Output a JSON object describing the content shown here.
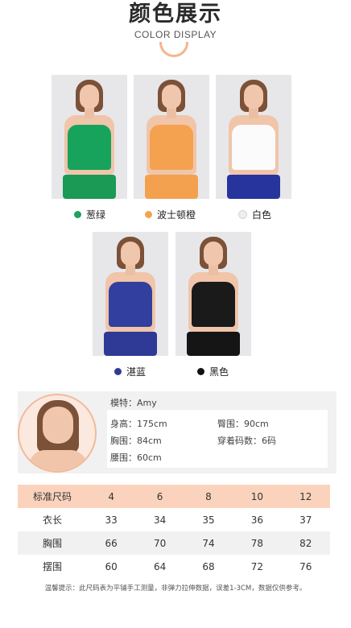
{
  "header": {
    "title": "颜色展示",
    "subtitle": "COLOR DISPLAY"
  },
  "colors": [
    {
      "name": "葱绿",
      "dot": "#1ea25c",
      "top": "#17a35b",
      "bottom": "#1a9a55"
    },
    {
      "name": "波士顿橙",
      "dot": "#f2a452",
      "top": "#f4a24f",
      "bottom": "#f3a14e"
    },
    {
      "name": "白色",
      "dot": "#eeeeee",
      "top": "#fbfbfb",
      "bottom": "#27349e"
    },
    {
      "name": "湛蓝",
      "dot": "#2f3a92",
      "top": "#323f9f",
      "bottom": "#2e3a95"
    },
    {
      "name": "黑色",
      "dot": "#111111",
      "top": "#1a1a1a",
      "bottom": "#151515"
    }
  ],
  "model": {
    "name_line": "模特：Amy",
    "height": "身高：175cm",
    "hip": "臀围：90cm",
    "chest": "胸围：84cm",
    "wear_size": "穿着码数：6码",
    "waist": "腰围：60cm"
  },
  "size_table": {
    "header": [
      "标准尺码",
      "4",
      "6",
      "8",
      "10",
      "12"
    ],
    "rows": [
      [
        "衣长",
        "33",
        "34",
        "35",
        "36",
        "37"
      ],
      [
        "胸围",
        "66",
        "70",
        "74",
        "78",
        "82"
      ],
      [
        "摆围",
        "60",
        "64",
        "68",
        "72",
        "76"
      ]
    ]
  },
  "note": "温馨提示：此尺码表为平铺手工测量，非弹力拉伸数据，误差1-3CM，数据仅供参考。"
}
